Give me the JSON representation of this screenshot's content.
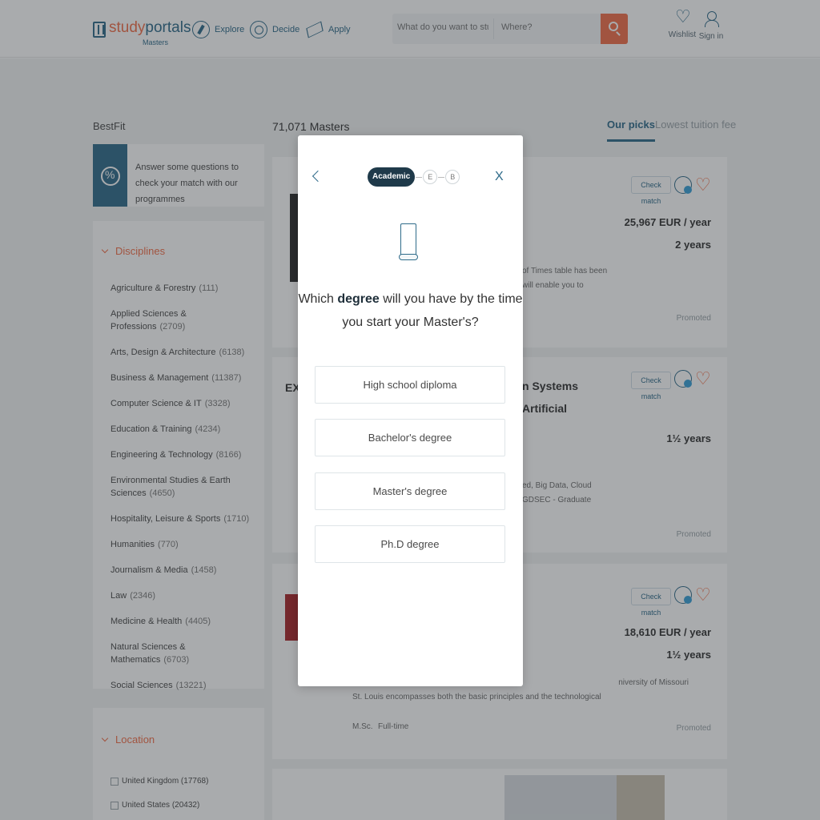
{
  "header": {
    "logo": {
      "study": "study",
      "portals": "portals",
      "sub": "Masters"
    },
    "nav": [
      {
        "label": "Explore",
        "icon": "compass-icon"
      },
      {
        "label": "Decide",
        "icon": "target-icon"
      },
      {
        "label": "Apply",
        "icon": "paper-plane-icon"
      }
    ],
    "search": {
      "what_placeholder": "What do you want to study?",
      "where_placeholder": "Where?"
    },
    "wishlist_label": "Wishlist",
    "signin_label": "Sign in"
  },
  "sidebar": {
    "bestfit_title": "BestFit",
    "bestfit_text": "Answer some questions to check your match with our programmes",
    "disciplines_title": "Disciplines",
    "disciplines": [
      {
        "label": "Agriculture & Forestry",
        "count": "(111)"
      },
      {
        "label": "Applied Sciences & Professions",
        "count": "(2709)"
      },
      {
        "label": "Arts, Design & Architecture",
        "count": "(6138)"
      },
      {
        "label": "Business & Management",
        "count": "(11387)"
      },
      {
        "label": "Computer Science & IT",
        "count": "(3328)"
      },
      {
        "label": "Education & Training",
        "count": "(4234)"
      },
      {
        "label": "Engineering & Technology",
        "count": "(8166)"
      },
      {
        "label": "Environmental Studies & Earth Sciences",
        "count": "(4650)"
      },
      {
        "label": "Hospitality, Leisure & Sports",
        "count": "(1710)"
      },
      {
        "label": "Humanities",
        "count": "(770)"
      },
      {
        "label": "Journalism & Media",
        "count": "(1458)"
      },
      {
        "label": "Law",
        "count": "(2346)"
      },
      {
        "label": "Medicine & Health",
        "count": "(4405)"
      },
      {
        "label": "Natural Sciences & Mathematics",
        "count": "(6703)"
      },
      {
        "label": "Social Sciences",
        "count": "(13221)"
      }
    ],
    "location_title": "Location",
    "locations": [
      "United Kingdom (17768)",
      "United States (20432)"
    ]
  },
  "results": {
    "count_label": "71,071 Masters",
    "sort_tabs": [
      "Our picks",
      "Lowest tuition fee"
    ],
    "cards": [
      {
        "check_label": "Check match",
        "price": "25,967 EUR / year",
        "duration": "2 years",
        "promoted": "Promoted",
        "snippet": [
          "of Times table has been",
          "will enable you to"
        ]
      },
      {
        "check_label": "Check match",
        "price": "",
        "duration": "1½ years",
        "promoted": "Promoted",
        "title_lines": [
          "n Systems",
          "Artificial"
        ],
        "title_prefix": "EX",
        "snippet": [
          "ed, Big Data, Cloud",
          "GDSEC - Graduate"
        ]
      },
      {
        "check_label": "Check match",
        "price": "18,610 EUR / year",
        "duration": "1½ years",
        "promoted": "Promoted",
        "snippet": [
          "niversity of Missouri",
          "St. Louis encompasses both the basic principles and the technological"
        ],
        "tags": [
          "M.Sc.",
          "Full-time"
        ]
      }
    ]
  },
  "modal": {
    "steps": [
      "Academic",
      "E",
      "B"
    ],
    "close": "X",
    "question_pre": "Which ",
    "question_bold": "degree",
    "question_post": " will you have by the time you start your Master's?",
    "options": [
      "High school diploma",
      "Bachelor's degree",
      "Master's degree",
      "Ph.D degree"
    ]
  }
}
